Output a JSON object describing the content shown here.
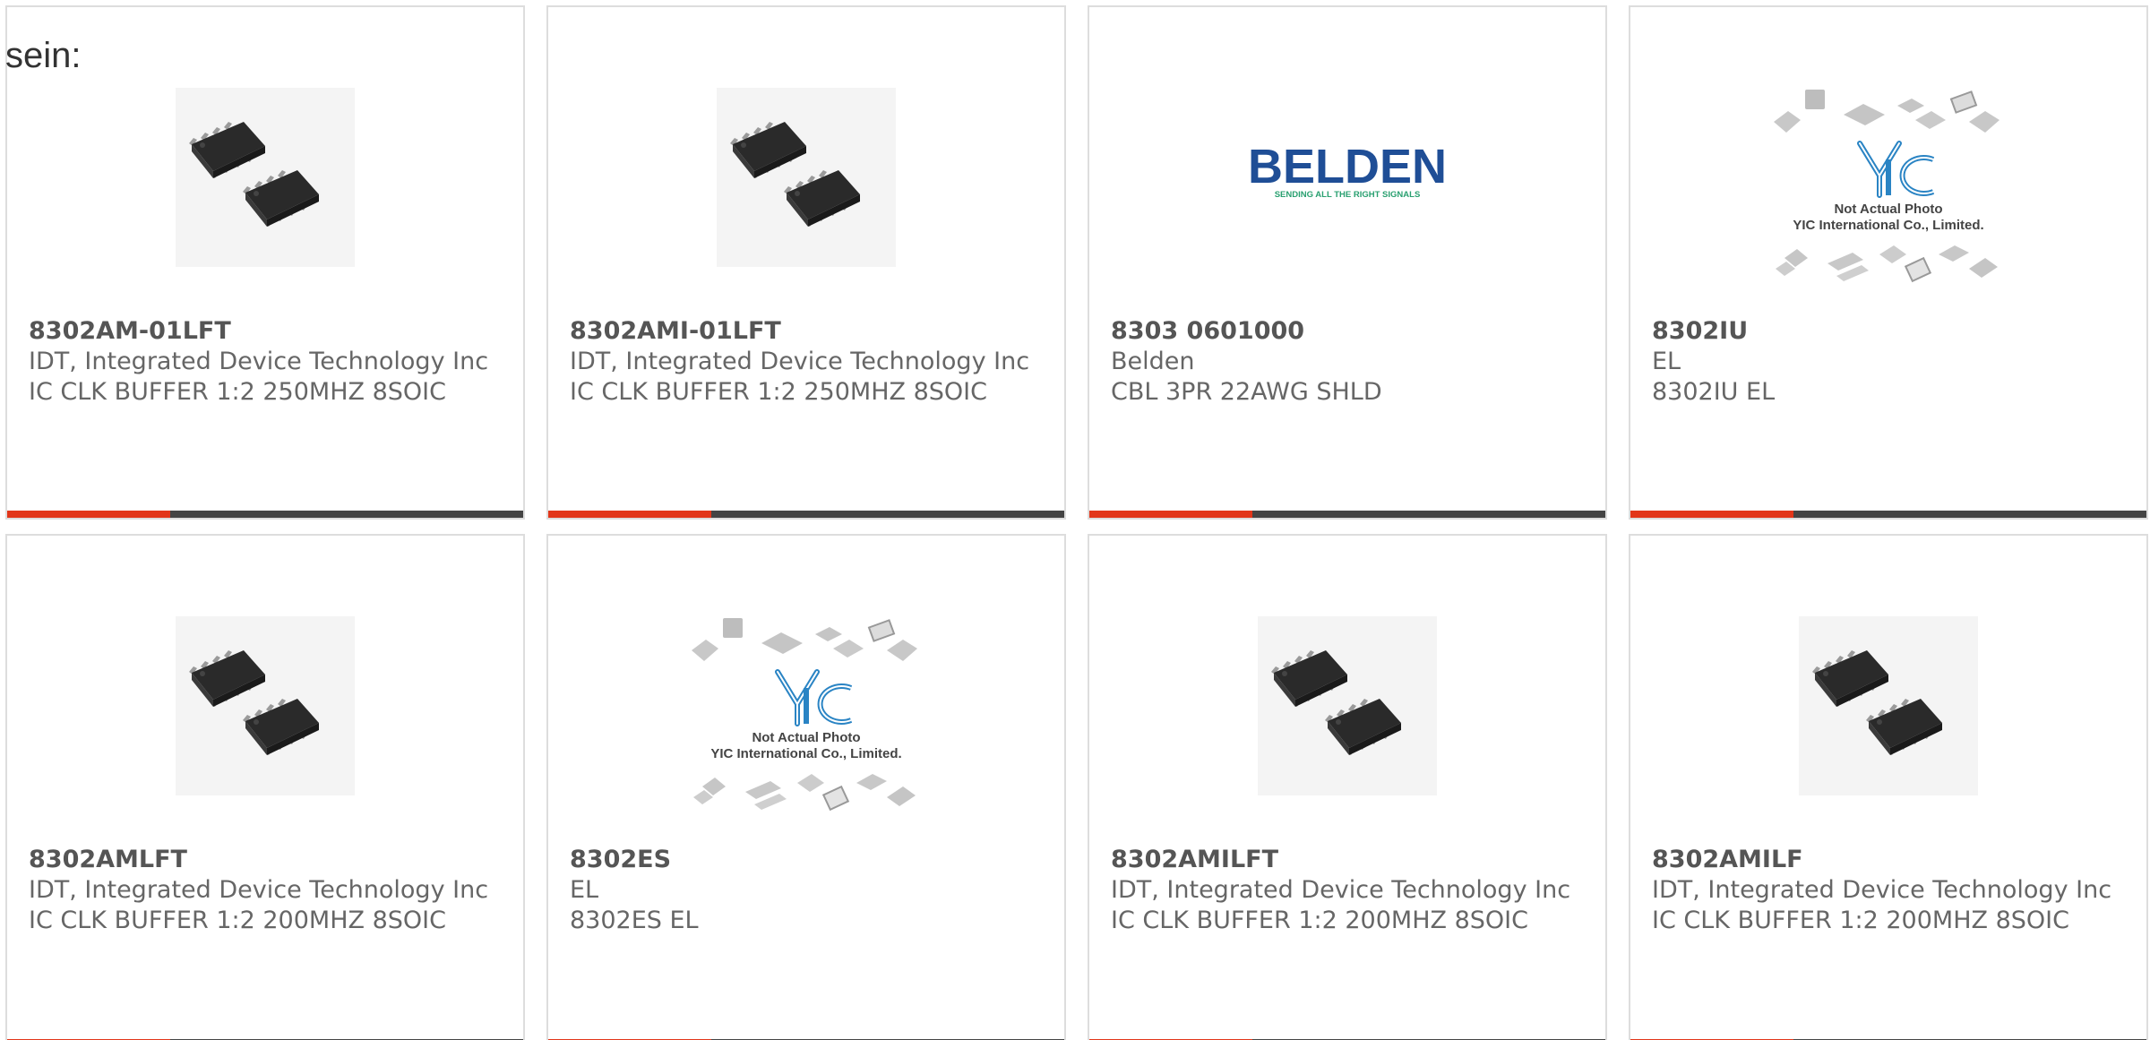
{
  "intro": {
    "text": "sein:"
  },
  "products": [
    {
      "part_number": "8302AM-01LFT",
      "manufacturer": "IDT, Integrated Device Technology Inc",
      "description": "IC CLK BUFFER 1:2 250MHZ 8SOIC",
      "image": "soic-chip"
    },
    {
      "part_number": "8302AMI-01LFT",
      "manufacturer": "IDT, Integrated Device Technology Inc",
      "description": "IC CLK BUFFER 1:2 250MHZ 8SOIC",
      "image": "soic-chip"
    },
    {
      "part_number": "8303 0601000",
      "manufacturer": "Belden",
      "description": "CBL 3PR 22AWG SHLD",
      "image": "belden-logo",
      "logo": {
        "brand": "BELDEN",
        "tagline": "SENDING ALL THE RIGHT SIGNALS"
      }
    },
    {
      "part_number": "8302IU",
      "manufacturer": "EL",
      "description": "8302IU EL",
      "image": "yic-placeholder",
      "placeholder": {
        "line1": "Not Actual Photo",
        "line2": "YIC International Co., Limited."
      }
    },
    {
      "part_number": "8302AMLFT",
      "manufacturer": "IDT, Integrated Device Technology Inc",
      "description": "IC CLK BUFFER 1:2 200MHZ 8SOIC",
      "image": "soic-chip"
    },
    {
      "part_number": "8302ES",
      "manufacturer": "EL",
      "description": "8302ES EL",
      "image": "yic-placeholder",
      "placeholder": {
        "line1": "Not Actual Photo",
        "line2": "YIC International Co., Limited."
      }
    },
    {
      "part_number": "8302AMILFT",
      "manufacturer": "IDT, Integrated Device Technology Inc",
      "description": "IC CLK BUFFER 1:2 200MHZ 8SOIC",
      "image": "soic-chip"
    },
    {
      "part_number": "8302AMILF",
      "manufacturer": "IDT, Integrated Device Technology Inc",
      "description": "IC CLK BUFFER 1:2 200MHZ 8SOIC",
      "image": "soic-chip"
    }
  ],
  "colors": {
    "accent": "#e2361a",
    "bar": "#444444",
    "text": "#666666",
    "belden_blue": "#1f4e96",
    "belden_green": "#29a070",
    "yic_blue": "#2a84c4"
  }
}
